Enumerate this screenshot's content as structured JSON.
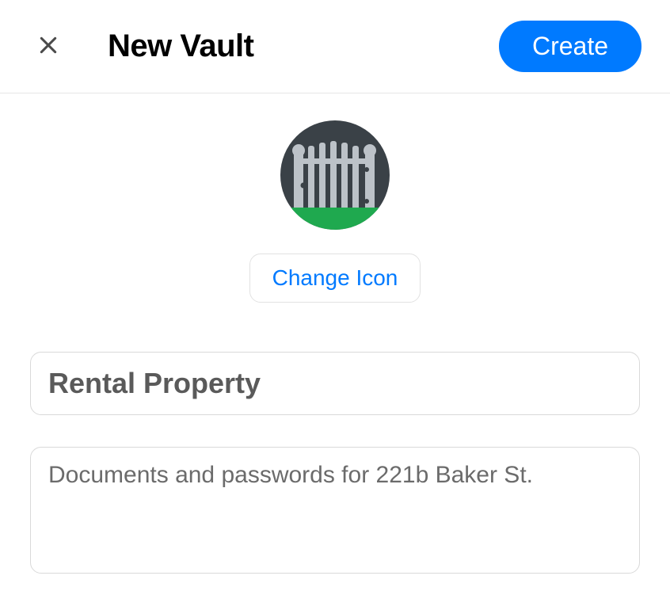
{
  "header": {
    "title": "New Vault",
    "create_label": "Create"
  },
  "icon": {
    "semantic": "gate-icon",
    "change_label": "Change Icon"
  },
  "form": {
    "name_placeholder": "Rental Property",
    "name_value": "",
    "description_placeholder": "Documents and passwords for 221b Baker St.",
    "description_value": ""
  },
  "colors": {
    "accent": "#007aff",
    "icon_bg": "#3a4147",
    "icon_ground": "#1fa94f",
    "icon_gate": "#bcc2c8"
  }
}
